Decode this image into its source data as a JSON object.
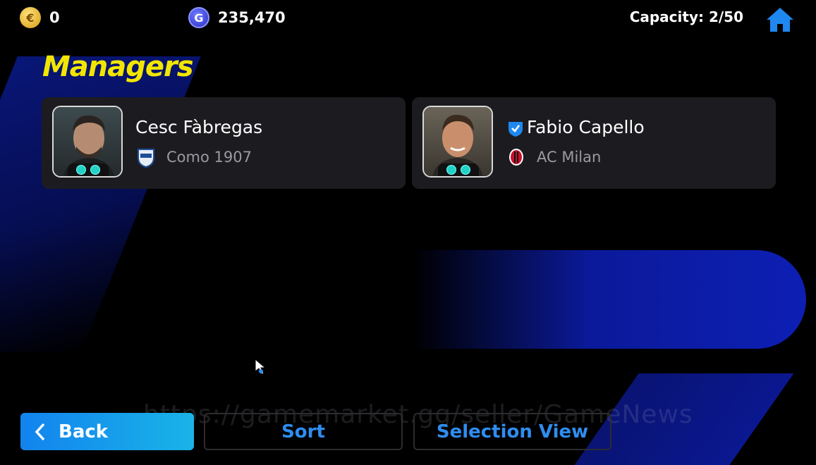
{
  "currency": {
    "efootball_coins": "0",
    "gp": "235,470"
  },
  "capacity": "Capacity: 2/50",
  "page_title": "Managers",
  "managers": [
    {
      "name": "Cesc Fàbregas",
      "club": "Como 1907",
      "verified": false
    },
    {
      "name": "Fabio Capello",
      "club": "AC Milan",
      "verified": true
    }
  ],
  "buttons": {
    "back": "Back",
    "sort": "Sort",
    "selection_view": "Selection View"
  },
  "watermark": "https://gamemarket.gg/seller/GameNews",
  "icons": {
    "coin": "efootball-coin-icon",
    "gp": "gp-coin-icon",
    "home": "home-icon",
    "back": "chevron-left-icon",
    "verified": "verified-shield-icon"
  },
  "colors": {
    "title": "#f2e600",
    "accent_blue": "#2e8df0",
    "back_button": "#1283ee"
  }
}
